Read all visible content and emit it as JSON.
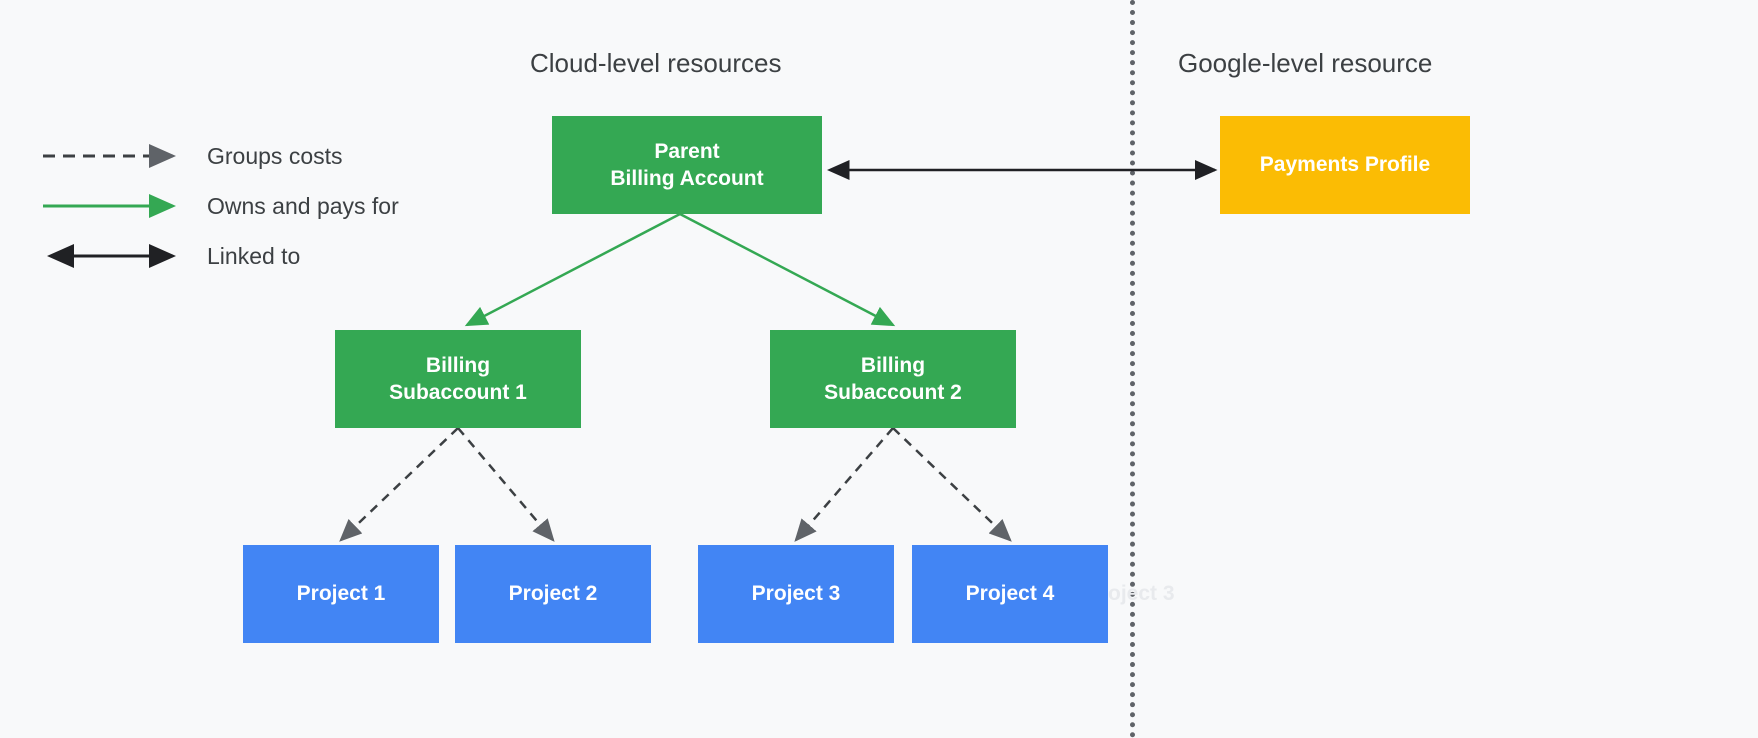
{
  "headers": {
    "cloud": "Cloud-level resources",
    "google": "Google-level resource"
  },
  "legend": {
    "groups_costs": "Groups costs",
    "owns_pays": "Owns and pays for",
    "linked_to": "Linked to"
  },
  "nodes": {
    "parent_billing": "Parent\nBilling Account",
    "sub1": "Billing\nSubaccount 1",
    "sub2": "Billing\nSubaccount 2",
    "project1": "Project 1",
    "project2": "Project 2",
    "project3": "Project 3",
    "project4": "Project 4",
    "payments": "Payments Profile"
  },
  "ghost": "oject 3",
  "colors": {
    "green": "#34a853",
    "blue": "#4285f4",
    "yellow": "#fbbc04",
    "gray": "#5f6368",
    "text": "#3c4043"
  }
}
